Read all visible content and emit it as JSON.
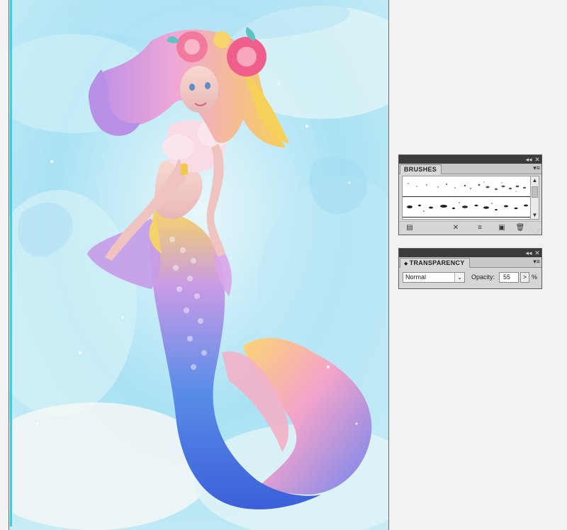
{
  "artwork": {
    "subject": "mermaid-illustration"
  },
  "brushes_panel": {
    "title": "BRUSHES",
    "collapse_icon": "◂◂",
    "close_icon": "✕",
    "menu_icon": "▾≡",
    "scroll_up": "▲",
    "scroll_down": "▼",
    "toolbar": {
      "library": "▤",
      "remove_stroke": "✕",
      "options": "≡",
      "new_brush": "▣",
      "delete": "🗑"
    },
    "grip": "⋰"
  },
  "transparency_panel": {
    "title": "TRANSPARENCY",
    "tab_arrow": "◆",
    "collapse_icon": "◂◂",
    "close_icon": "✕",
    "menu_icon": "▾≡",
    "blend_mode": "Normal",
    "blend_dropdown": "⌄",
    "opacity_label": "Opacity:",
    "opacity_value": "55",
    "opacity_arrow": ">",
    "opacity_unit": "%"
  },
  "colors": {
    "artboard_edge": "#35cfe6",
    "panel_bg": "#d6d6d6",
    "panel_bar": "#3b3b3b"
  }
}
